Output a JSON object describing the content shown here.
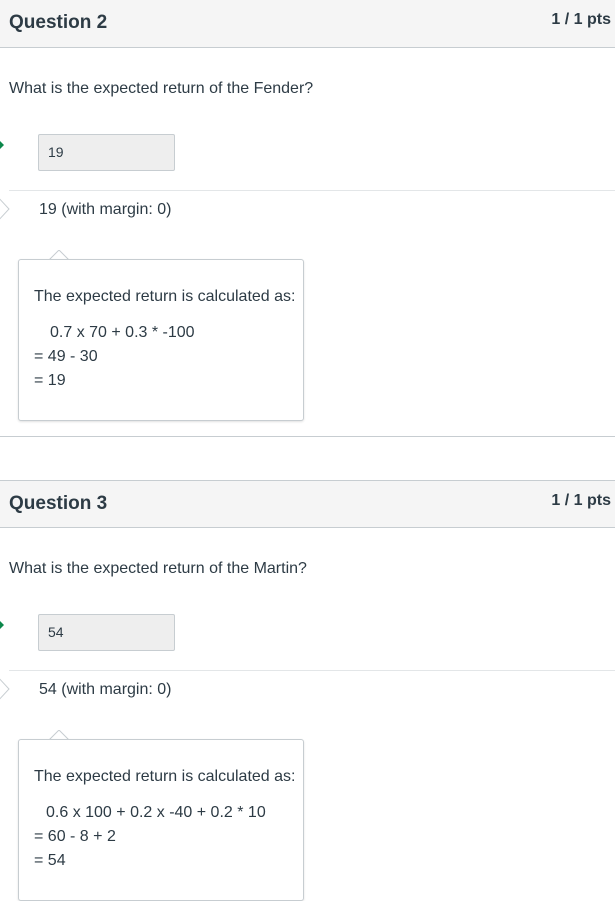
{
  "questions": [
    {
      "title": "Question 2",
      "points": "1 / 1 pts",
      "text": "What is the expected return of the Fender?",
      "answer": "19",
      "range": "19 (with margin: 0)",
      "comment": {
        "intro": "The expected return is calculated as:",
        "line1": "0.7 x 70 + 0.3 * -100",
        "line2": "= 49 - 30",
        "line3": "= 19"
      }
    },
    {
      "title": "Question 3",
      "points": "1 / 1 pts",
      "text": "What is the expected return of the Martin?",
      "answer": "54",
      "range": "54 (with margin: 0)",
      "comment": {
        "intro": "The expected return is calculated as:",
        "line1": "0.6 x 100 + 0.2 x -40 + 0.2 * 10",
        "line2": "= 60 - 8 + 2",
        "line3": "= 54"
      }
    }
  ],
  "colors": {
    "correct": "#0b874b",
    "header_bg": "#f5f5f5",
    "text": "#2d3b45",
    "border": "#c7cdd1"
  },
  "icons": {
    "correct_answer": "correct-arrow-icon",
    "correct_range": "range-arrow-icon"
  }
}
